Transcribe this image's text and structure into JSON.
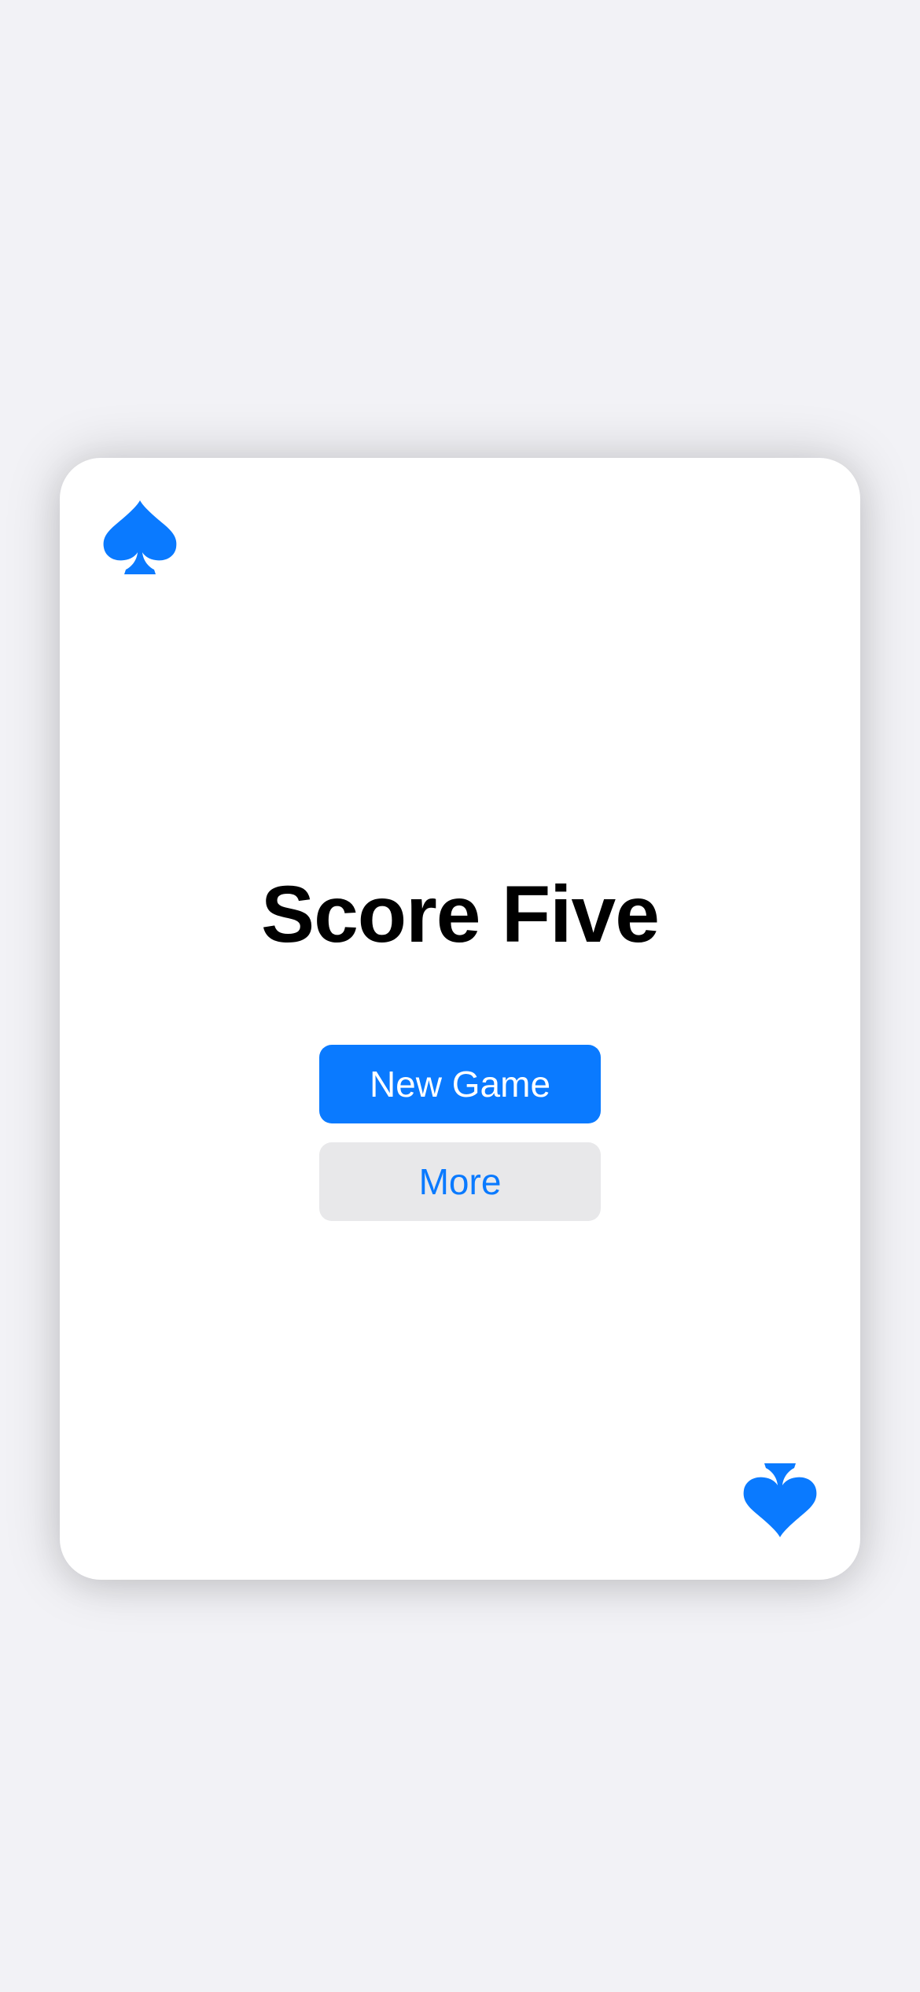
{
  "app": {
    "title": "Score Five",
    "accent_color": "#0a7aff",
    "background_color": "#f2f2f6"
  },
  "card": {
    "corner_icon": "spade-icon"
  },
  "actions": {
    "new_game_label": "New Game",
    "more_label": "More"
  }
}
